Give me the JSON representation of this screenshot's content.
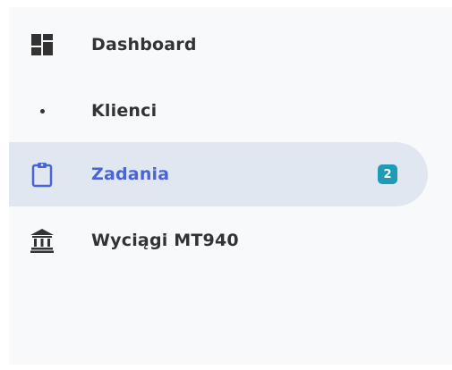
{
  "sidebar": {
    "items": [
      {
        "label": "Dashboard",
        "icon": "dashboard-icon",
        "active": false
      },
      {
        "label": "Klienci",
        "icon": "bullet-dot-icon",
        "active": false
      },
      {
        "label": "Zadania",
        "icon": "clipboard-icon",
        "active": true,
        "badge": "2"
      },
      {
        "label": "Wyciągi MT940",
        "icon": "bank-icon",
        "active": false
      }
    ]
  },
  "colors": {
    "active_background": "#e1e7f0",
    "active_text": "#4a63d6",
    "badge_background": "#1e9bb6",
    "text": "#333333"
  }
}
